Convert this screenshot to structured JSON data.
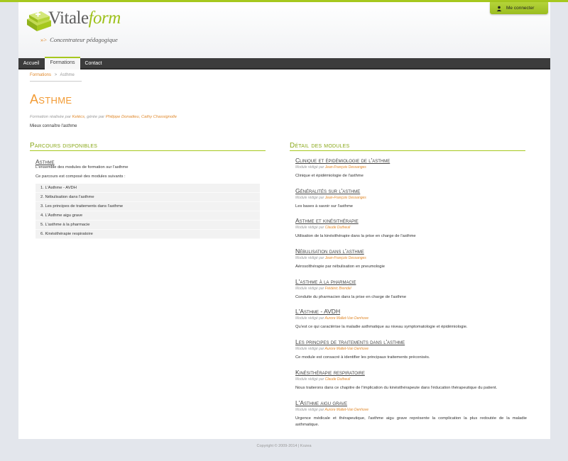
{
  "colors": {
    "accent_green": "#a6c81e",
    "accent_orange": "#f29a33",
    "nav_bg": "#3c3c3c",
    "page_bg": "#e3e6ec"
  },
  "logo": {
    "word_main": "Vitale",
    "word_accent": "form",
    "tagline": "Concentrateur pédagogique",
    "tagline_marker": "»>",
    "icon": "stacked-books-icon"
  },
  "header": {
    "login_label": "Me connecter",
    "login_icon": "user-icon"
  },
  "nav": {
    "items": [
      {
        "label": "Accueil"
      },
      {
        "label": "Formations"
      },
      {
        "label": "Contact"
      }
    ],
    "active": "Formations"
  },
  "breadcrumb": {
    "link": "Formations",
    "separator": ">",
    "current": "Asthme"
  },
  "page": {
    "title": "Asthme",
    "meta_prefix": "Formation réalisée par",
    "meta_org": "Kelécs",
    "meta_mid": ", gérée par",
    "meta_managers": "Philippe Donadieu, Cathy Chassignolle",
    "intro": "Mieux connaître l'asthme"
  },
  "parcours": {
    "section_title": "Parcours disponibles",
    "title": "Asthme",
    "desc": "L'ensemble des modules de formation sur l'asthme",
    "composition": "Ce parcours est composé des modules suivants :",
    "modules": [
      "1. L'Asthme - AVDH",
      "2. Nébulisation dans l'asthme",
      "3. Les principes de traitements dans l'asthme",
      "4. L'Asthme aigu grave",
      "5. L'asthme à la pharmacie",
      "6. Kinésithérapie respiratoire"
    ]
  },
  "detail": {
    "section_title": "Détail des modules",
    "author_prefix": "Module rédigé par",
    "modules": [
      {
        "title": "Clinique et épidémiologie de l'asthme",
        "author": "Jean-François Dessanges",
        "desc": "Clinique et épidémiologie de l'asthme"
      },
      {
        "title": "Généralités sur l'asthme",
        "author": "Jean-François Dessanges",
        "desc": "Les bases à savoir sur l'asthme"
      },
      {
        "title": "Asthme et kinésithérapie",
        "author": "Claude Dutheuil",
        "desc": "Utilisation de la kinésithérapie dans la prise en charge de l'asthme"
      },
      {
        "title": "Nébulisation dans l'asthme",
        "author": "Jean-François Dessanges",
        "desc": "Aérosolthérapie par nébulisation en pneumologie"
      },
      {
        "title": "L'asthme à la pharmacie",
        "author": "Frédéric Brendel",
        "desc": "Conduite du pharmacien dans la prise en charge de l'asthme"
      },
      {
        "title": "L'Asthme - AVDH",
        "author": "Aurore Mallet-Van Denhove",
        "desc": "Qu'est ce qui caractérise la maladie asthmatique au niveau symptomatologie et épidémiologie."
      },
      {
        "title": "Les principes de traitements dans l'asthme",
        "author": "Aurore Mallet-Van Denhove",
        "desc": "Ce module est consacré à identifier les principaux traitements préconisés."
      },
      {
        "title": "Kinésithérapie respiratoire",
        "author": "Claude Dutheuil",
        "desc": "Nous traiterons dans ce chapitre de l'implication du kinésithérapeute dans l'éducation thérapeutique du patient."
      },
      {
        "title": "L'Asthme aigu grave",
        "author": "Aurore Mallet-Van Denhove",
        "desc": "Urgence médicale et thérapeutique, l'asthme aigu grave représente la complication la plus redoutée de la maladie asthmatique."
      }
    ]
  },
  "footer": {
    "text": "Copyright © 2009-2014  |  Kozea"
  }
}
